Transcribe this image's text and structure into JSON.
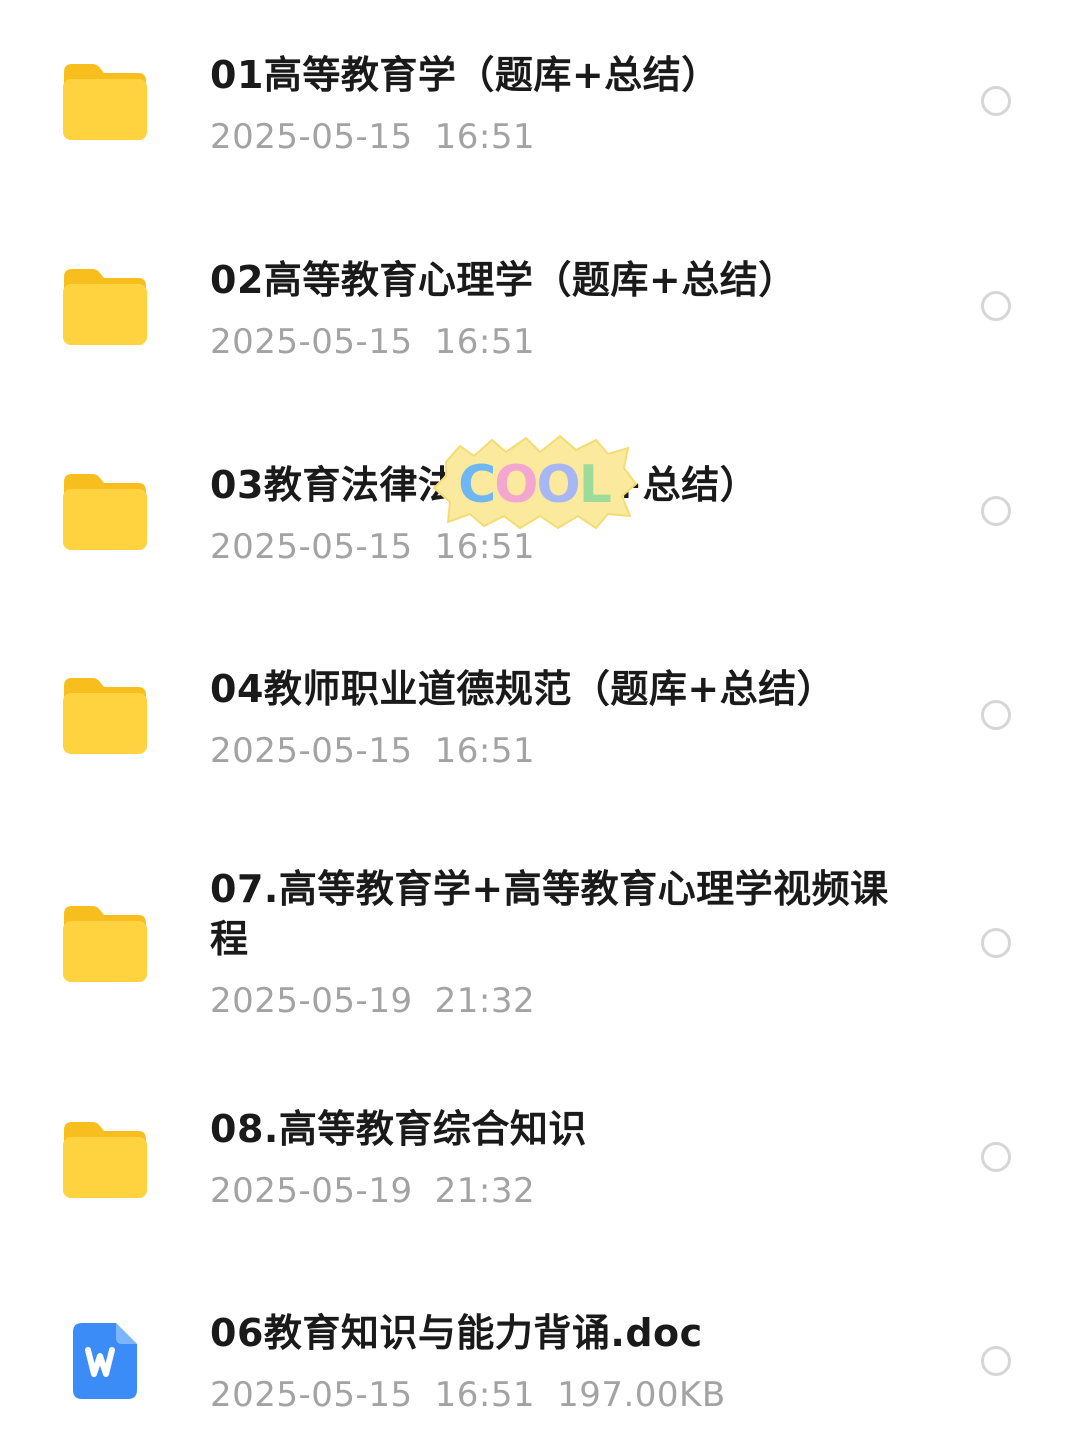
{
  "files": [
    {
      "name": "01高等教育学（题库+总结）",
      "date": "2025-05-15",
      "time": "16:51",
      "size": "",
      "type": "folder",
      "icon": "folder-icon"
    },
    {
      "name": "02高等教育心理学（题库+总结）",
      "date": "2025-05-15",
      "time": "16:51",
      "size": "",
      "type": "folder",
      "icon": "folder-icon"
    },
    {
      "name": "03教育法律法规（题库+总结）",
      "date": "2025-05-15",
      "time": "16:51",
      "size": "",
      "type": "folder",
      "icon": "folder-icon"
    },
    {
      "name": "04教师职业道德规范（题库+总结）",
      "date": "2025-05-15",
      "time": "16:51",
      "size": "",
      "type": "folder",
      "icon": "folder-icon"
    },
    {
      "name": "07.高等教育学+高等教育心理学视频课程",
      "date": "2025-05-19",
      "time": "21:32",
      "size": "",
      "type": "folder",
      "icon": "folder-icon"
    },
    {
      "name": "08.高等教育综合知识",
      "date": "2025-05-19",
      "time": "21:32",
      "size": "",
      "type": "folder",
      "icon": "folder-icon"
    },
    {
      "name": "06教育知识与能力背诵.doc",
      "date": "2025-05-15",
      "time": "16:51",
      "size": "197.00KB",
      "type": "doc",
      "icon": "word-doc-icon"
    }
  ],
  "sticker": {
    "text": "COOL",
    "icon": "cool-sticker"
  },
  "colors": {
    "folder": "#FFD23F",
    "folder_dark": "#F7BE1E",
    "word": "#3C8CF7",
    "title": "#1a1a1a",
    "meta": "#a3a3a3"
  }
}
